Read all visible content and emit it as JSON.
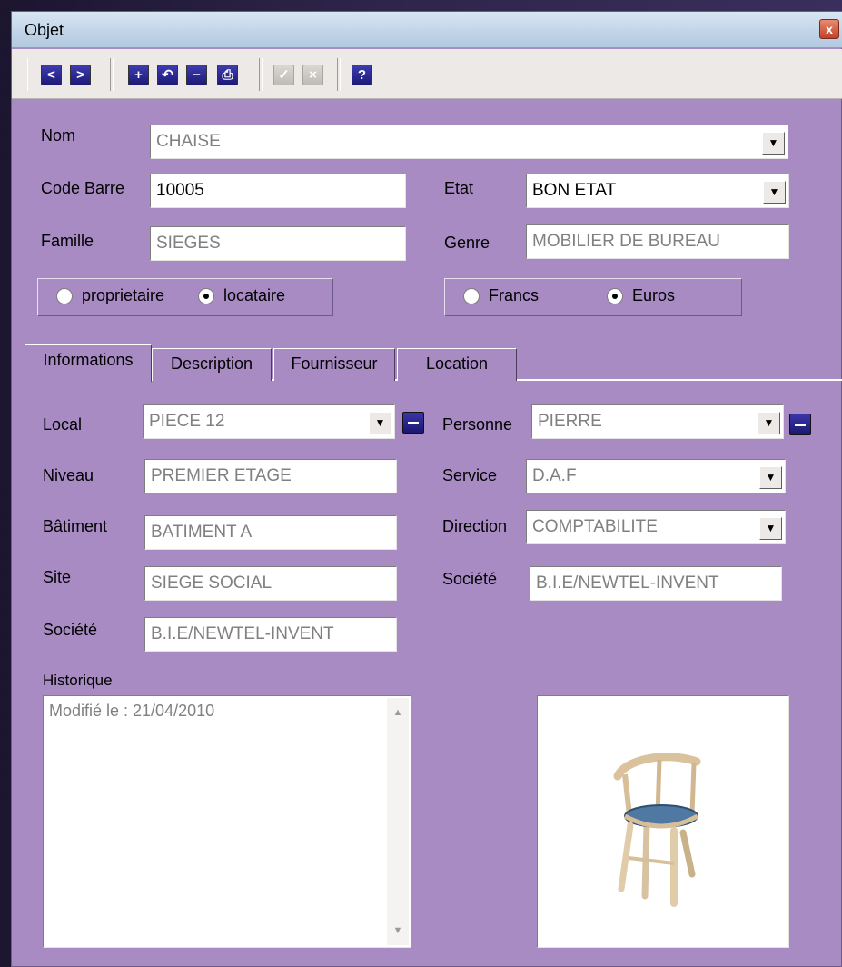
{
  "window": {
    "title": "Objet",
    "close_label": "x"
  },
  "toolbar": {
    "prev_label": "<",
    "next_label": ">",
    "add_label": "+",
    "undo_label": "↶",
    "remove_label": "−",
    "print_label": "⎙",
    "validate_label": "✓",
    "cancel_label": "×",
    "help_label": "?"
  },
  "form": {
    "nom_label": "Nom",
    "nom_value": "CHAISE",
    "code_barre_label": "Code Barre",
    "code_barre_value": "10005",
    "etat_label": "Etat",
    "etat_value": "BON ETAT",
    "famille_label": "Famille",
    "famille_value": "SIEGES",
    "genre_label": "Genre",
    "genre_value": "MOBILIER DE BUREAU",
    "ownership": {
      "proprietaire": "proprietaire",
      "locataire": "locataire",
      "selected": "locataire"
    },
    "currency": {
      "francs": "Francs",
      "euros": "Euros",
      "selected": "Euros"
    }
  },
  "tabs": [
    {
      "label": "Informations",
      "active": true
    },
    {
      "label": "Description",
      "active": false
    },
    {
      "label": "Fournisseur",
      "active": false
    },
    {
      "label": "Location",
      "active": false
    }
  ],
  "info": {
    "local_label": "Local",
    "local_value": "PIECE 12",
    "niveau_label": "Niveau",
    "niveau_value": "PREMIER ETAGE",
    "batiment_label": "Bâtiment",
    "batiment_value": "BATIMENT A",
    "site_label": "Site",
    "site_value": "SIEGE  SOCIAL",
    "societe_left_label": "Société",
    "societe_left_value": "B.I.E/NEWTEL-INVENT",
    "personne_label": "Personne",
    "personne_value": "PIERRE",
    "service_label": "Service",
    "service_value": "D.A.F",
    "direction_label": "Direction",
    "direction_value": "COMPTABILITE",
    "societe_right_label": "Société",
    "societe_right_value": "B.I.E/NEWTEL-INVENT",
    "historique_label": "Historique",
    "historique_text": "Modifié le  : 21/04/2010"
  },
  "colors": {
    "background": "#a98bc4",
    "button_blue": "#2a27a0",
    "seat_blue": "#4f78a3"
  }
}
